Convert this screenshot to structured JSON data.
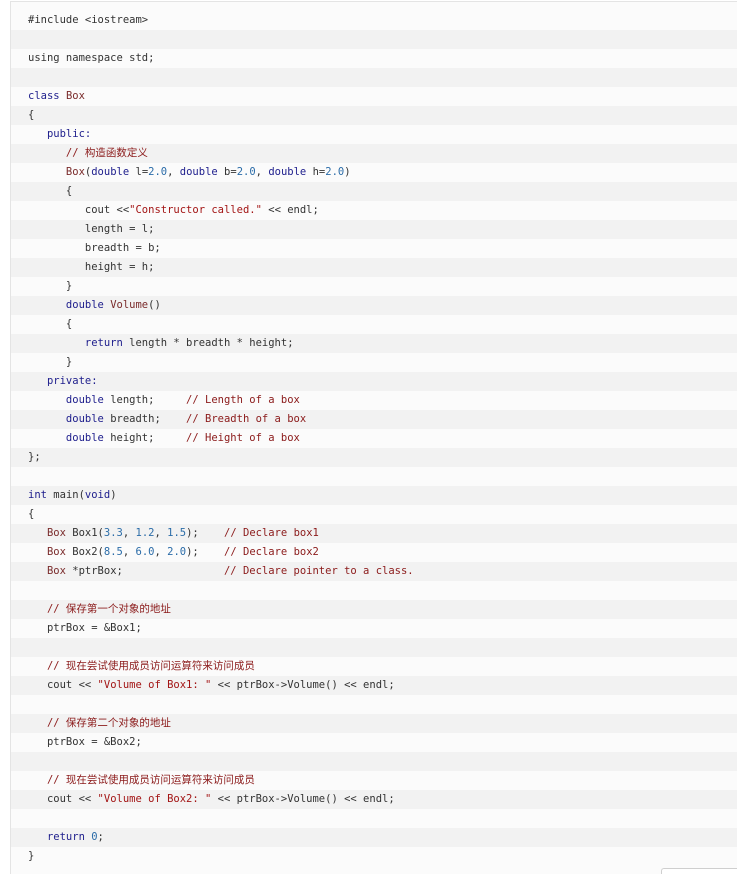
{
  "code": {
    "language": "cpp",
    "lines": [
      [
        {
          "t": "#include <iostream>",
          "c": "pl"
        }
      ],
      [],
      [
        {
          "t": "using namespace std;",
          "c": "pl"
        }
      ],
      [],
      [
        {
          "t": "class ",
          "c": "kw"
        },
        {
          "t": "Box",
          "c": "type"
        }
      ],
      [
        {
          "t": "{",
          "c": "pl"
        }
      ],
      [
        {
          "t": "   public:",
          "c": "kw"
        }
      ],
      [
        {
          "t": "      // 构造函数定义",
          "c": "com"
        }
      ],
      [
        {
          "t": "      Box",
          "c": "type"
        },
        {
          "t": "(",
          "c": "pl"
        },
        {
          "t": "double ",
          "c": "kw"
        },
        {
          "t": "l=",
          "c": "pl"
        },
        {
          "t": "2.0",
          "c": "num"
        },
        {
          "t": ", ",
          "c": "pl"
        },
        {
          "t": "double ",
          "c": "kw"
        },
        {
          "t": "b=",
          "c": "pl"
        },
        {
          "t": "2.0",
          "c": "num"
        },
        {
          "t": ", ",
          "c": "pl"
        },
        {
          "t": "double ",
          "c": "kw"
        },
        {
          "t": "h=",
          "c": "pl"
        },
        {
          "t": "2.0",
          "c": "num"
        },
        {
          "t": ")",
          "c": "pl"
        }
      ],
      [
        {
          "t": "      {",
          "c": "pl"
        }
      ],
      [
        {
          "t": "         cout <<",
          "c": "pl"
        },
        {
          "t": "\"Constructor called.\"",
          "c": "str"
        },
        {
          "t": " << endl;",
          "c": "pl"
        }
      ],
      [
        {
          "t": "         length = l;",
          "c": "pl"
        }
      ],
      [
        {
          "t": "         breadth = b;",
          "c": "pl"
        }
      ],
      [
        {
          "t": "         height = h;",
          "c": "pl"
        }
      ],
      [
        {
          "t": "      }",
          "c": "pl"
        }
      ],
      [
        {
          "t": "      double ",
          "c": "kw"
        },
        {
          "t": "Volume",
          "c": "type"
        },
        {
          "t": "()",
          "c": "pl"
        }
      ],
      [
        {
          "t": "      {",
          "c": "pl"
        }
      ],
      [
        {
          "t": "         return ",
          "c": "kw"
        },
        {
          "t": "length * breadth * height;",
          "c": "pl"
        }
      ],
      [
        {
          "t": "      }",
          "c": "pl"
        }
      ],
      [
        {
          "t": "   private:",
          "c": "kw"
        }
      ],
      [
        {
          "t": "      double ",
          "c": "kw"
        },
        {
          "t": "length;     ",
          "c": "pl"
        },
        {
          "t": "// Length of a box",
          "c": "com"
        }
      ],
      [
        {
          "t": "      double ",
          "c": "kw"
        },
        {
          "t": "breadth;    ",
          "c": "pl"
        },
        {
          "t": "// Breadth of a box",
          "c": "com"
        }
      ],
      [
        {
          "t": "      double ",
          "c": "kw"
        },
        {
          "t": "height;     ",
          "c": "pl"
        },
        {
          "t": "// Height of a box",
          "c": "com"
        }
      ],
      [
        {
          "t": "};",
          "c": "pl"
        }
      ],
      [],
      [
        {
          "t": "int ",
          "c": "kw"
        },
        {
          "t": "main(",
          "c": "pl"
        },
        {
          "t": "void",
          "c": "kw"
        },
        {
          "t": ")",
          "c": "pl"
        }
      ],
      [
        {
          "t": "{",
          "c": "pl"
        }
      ],
      [
        {
          "t": "   Box ",
          "c": "type"
        },
        {
          "t": "Box1(",
          "c": "pl"
        },
        {
          "t": "3.3",
          "c": "num"
        },
        {
          "t": ", ",
          "c": "pl"
        },
        {
          "t": "1.2",
          "c": "num"
        },
        {
          "t": ", ",
          "c": "pl"
        },
        {
          "t": "1.5",
          "c": "num"
        },
        {
          "t": ");    ",
          "c": "pl"
        },
        {
          "t": "// Declare box1",
          "c": "com"
        }
      ],
      [
        {
          "t": "   Box ",
          "c": "type"
        },
        {
          "t": "Box2(",
          "c": "pl"
        },
        {
          "t": "8.5",
          "c": "num"
        },
        {
          "t": ", ",
          "c": "pl"
        },
        {
          "t": "6.0",
          "c": "num"
        },
        {
          "t": ", ",
          "c": "pl"
        },
        {
          "t": "2.0",
          "c": "num"
        },
        {
          "t": ");    ",
          "c": "pl"
        },
        {
          "t": "// Declare box2",
          "c": "com"
        }
      ],
      [
        {
          "t": "   Box ",
          "c": "type"
        },
        {
          "t": "*ptrBox;                ",
          "c": "pl"
        },
        {
          "t": "// Declare pointer to a class.",
          "c": "com"
        }
      ],
      [],
      [
        {
          "t": "   // 保存第一个对象的地址",
          "c": "com"
        }
      ],
      [
        {
          "t": "   ptrBox = &Box1;",
          "c": "pl"
        }
      ],
      [],
      [
        {
          "t": "   // 现在尝试使用成员访问运算符来访问成员",
          "c": "com"
        }
      ],
      [
        {
          "t": "   cout << ",
          "c": "pl"
        },
        {
          "t": "\"Volume of Box1: \"",
          "c": "str"
        },
        {
          "t": " << ptrBox->Volume() << endl;",
          "c": "pl"
        }
      ],
      [],
      [
        {
          "t": "   // 保存第二个对象的地址",
          "c": "com"
        }
      ],
      [
        {
          "t": "   ptrBox = &Box2;",
          "c": "pl"
        }
      ],
      [],
      [
        {
          "t": "   // 现在尝试使用成员访问运算符来访问成员",
          "c": "com"
        }
      ],
      [
        {
          "t": "   cout << ",
          "c": "pl"
        },
        {
          "t": "\"Volume of Box2: \"",
          "c": "str"
        },
        {
          "t": " << ptrBox->Volume() << endl;",
          "c": "pl"
        }
      ],
      [],
      [
        {
          "t": "   return ",
          "c": "kw"
        },
        {
          "t": "0",
          "c": "num"
        },
        {
          "t": ";",
          "c": "pl"
        }
      ],
      [
        {
          "t": "}",
          "c": "pl"
        }
      ]
    ]
  },
  "colors": {
    "keyword": "#1d1d8c",
    "string": "#a31515",
    "comment": "#8b1a1a",
    "number": "#2b6ca8",
    "type": "#7a2b2b",
    "text": "#333333",
    "row_alt": "#f2f2f2"
  }
}
